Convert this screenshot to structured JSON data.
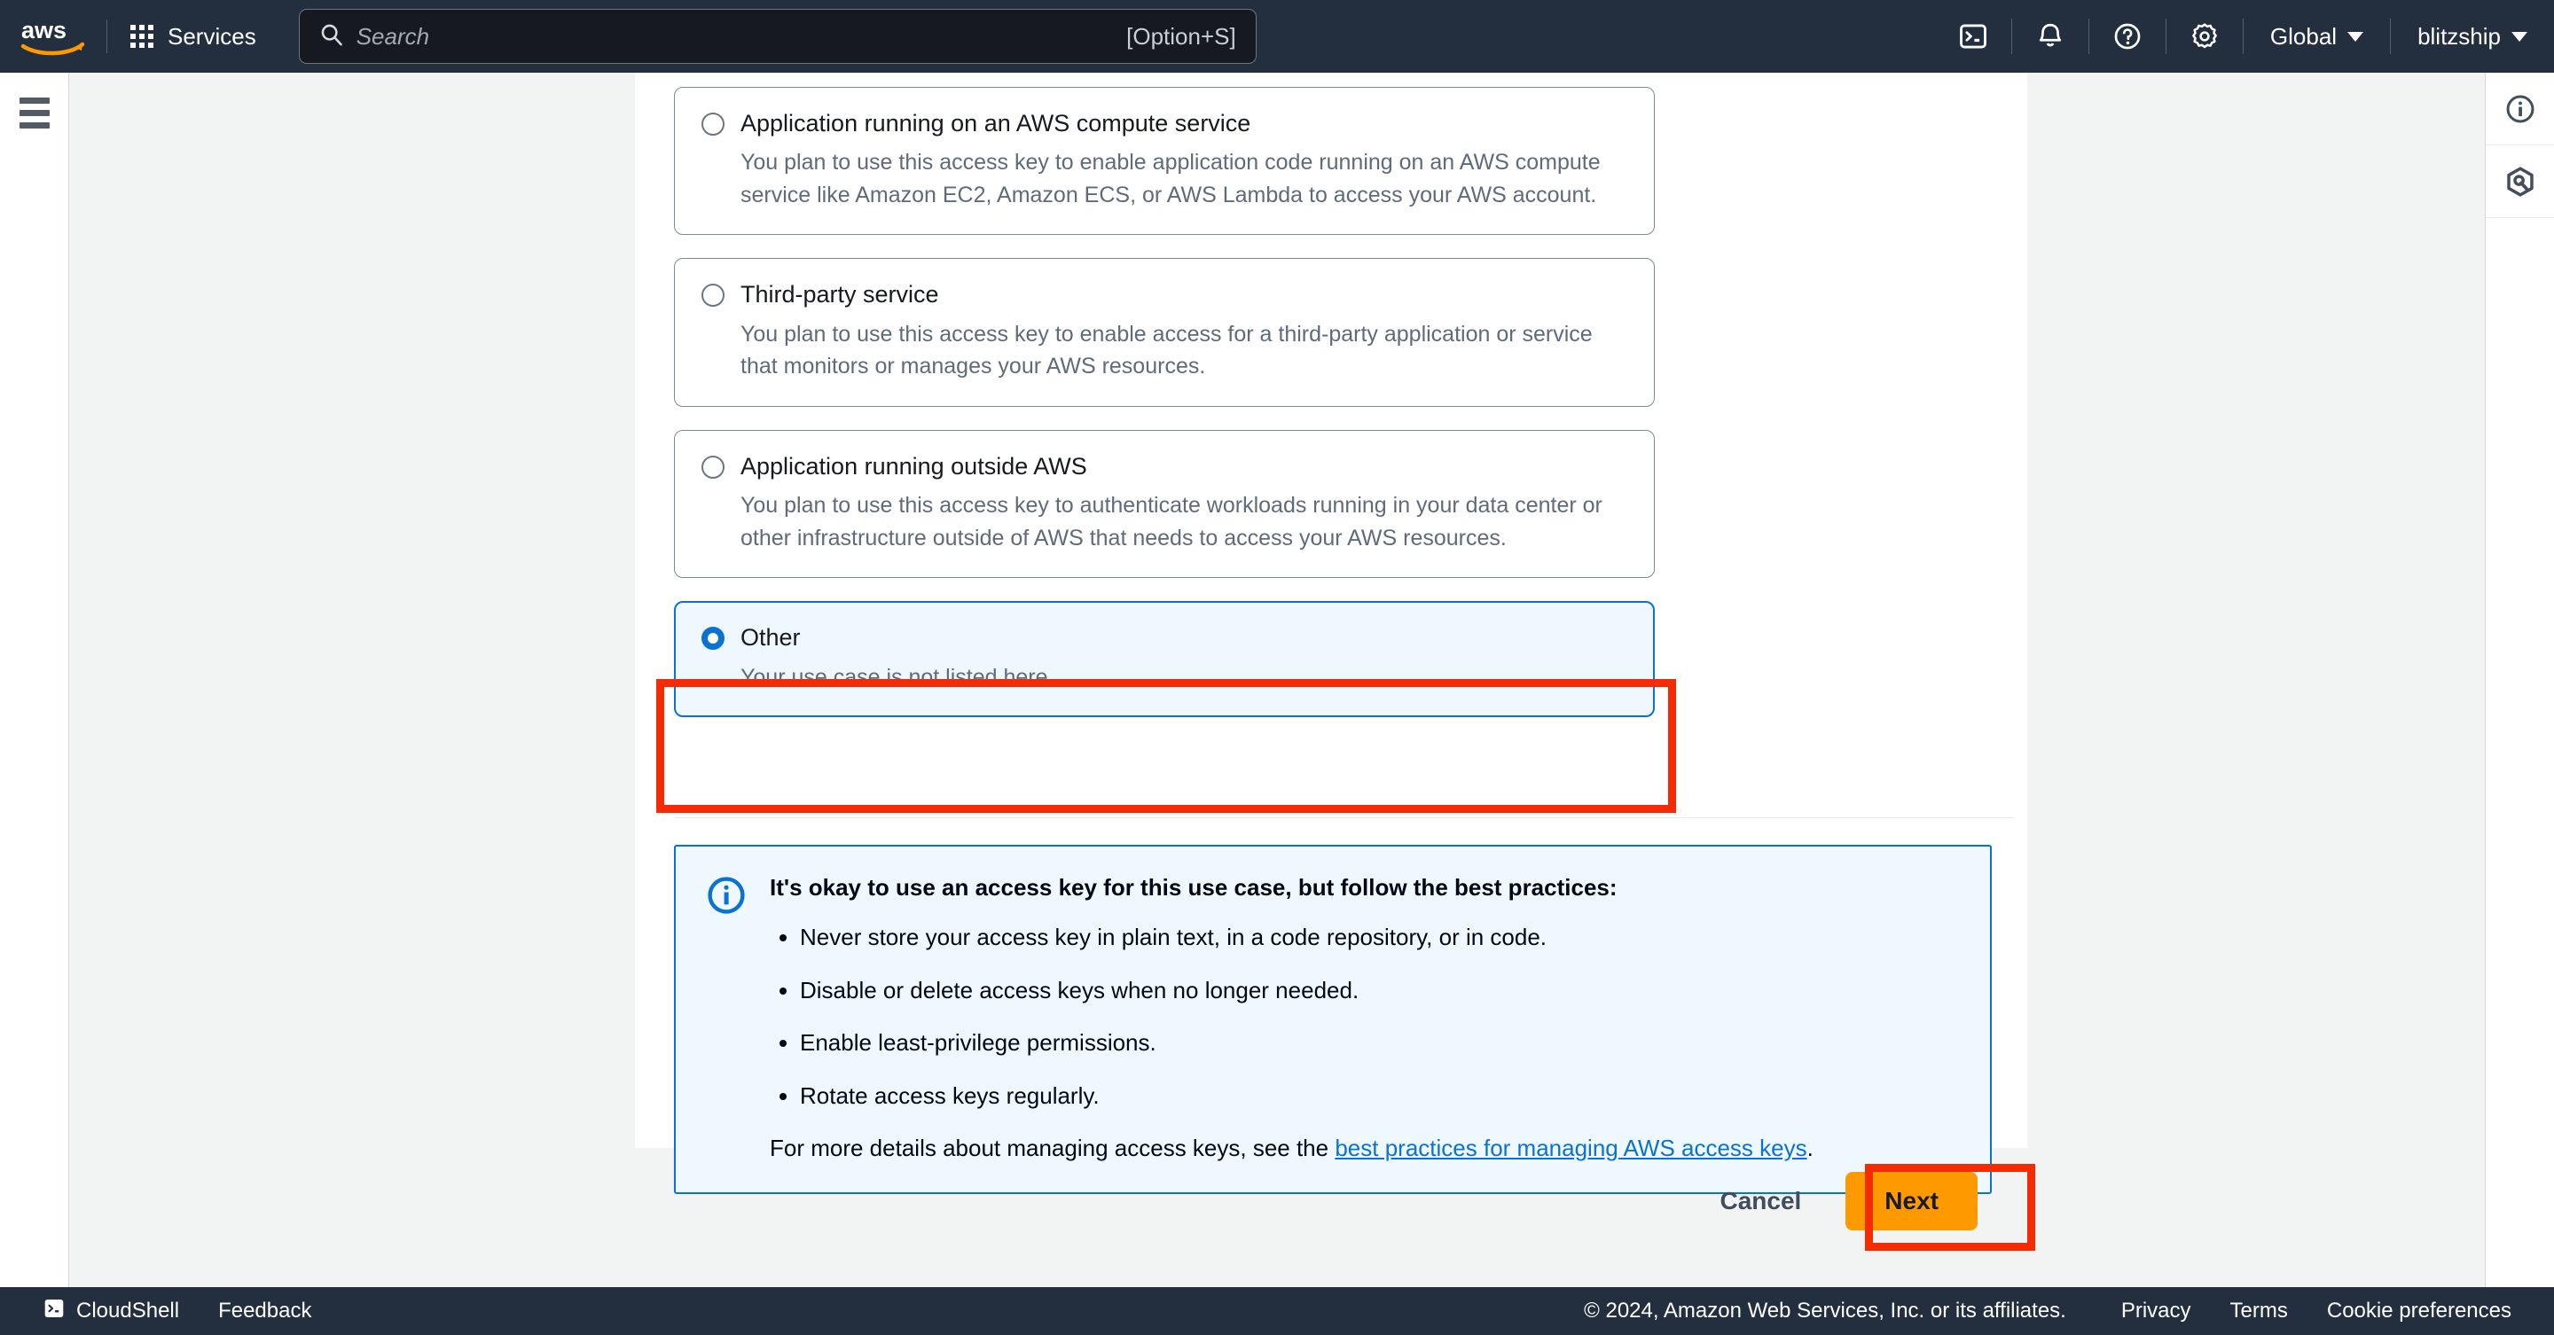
{
  "topnav": {
    "logo_alt": "aws",
    "services_label": "Services",
    "search": {
      "placeholder": "Search",
      "shortcut": "[Option+S]"
    },
    "icons": [
      {
        "name": "cloudshell-icon"
      },
      {
        "name": "notifications-bell-icon"
      },
      {
        "name": "help-question-icon"
      },
      {
        "name": "settings-gear-icon"
      }
    ],
    "region_label": "Global",
    "account_label": "blitzship"
  },
  "right_rail": {
    "info_label": "info-panel",
    "q_label": "amazon-q"
  },
  "main": {
    "options": [
      {
        "title": "Application running on an AWS compute service",
        "desc": "You plan to use this access key to enable application code running on an AWS compute service like Amazon EC2, Amazon ECS, or AWS Lambda to access your AWS account.",
        "selected": false
      },
      {
        "title": "Third-party service",
        "desc": "You plan to use this access key to enable access for a third-party application or service that monitors or manages your AWS resources.",
        "selected": false
      },
      {
        "title": "Application running outside AWS",
        "desc": "You plan to use this access key to authenticate workloads running in your data center or other infrastructure outside of AWS that needs to access your AWS resources.",
        "selected": false
      },
      {
        "title": "Other",
        "desc": "Your use case is not listed here.",
        "selected": true
      }
    ],
    "alert": {
      "title": "It's okay to use an access key for this use case, but follow the best practices:",
      "bullets": [
        "Never store your access key in plain text, in a code repository, or in code.",
        "Disable or delete access keys when no longer needed.",
        "Enable least-privilege permissions.",
        "Rotate access keys regularly."
      ],
      "tail_prefix": "For more details about managing access keys, see the ",
      "tail_link": "best practices for managing AWS access keys",
      "tail_suffix": "."
    },
    "actions": {
      "cancel_label": "Cancel",
      "next_label": "Next"
    }
  },
  "footer": {
    "cloudshell_label": "CloudShell",
    "feedback_label": "Feedback",
    "copyright": "© 2024, Amazon Web Services, Inc. or its affiliates.",
    "links": [
      "Privacy",
      "Terms",
      "Cookie preferences"
    ]
  },
  "colors": {
    "nav_bg": "#232f3e",
    "accent_orange": "#ff9900",
    "link_blue": "#0972d3",
    "annotation_red": "#f42b03",
    "selected_bg": "#f0f8ff"
  }
}
